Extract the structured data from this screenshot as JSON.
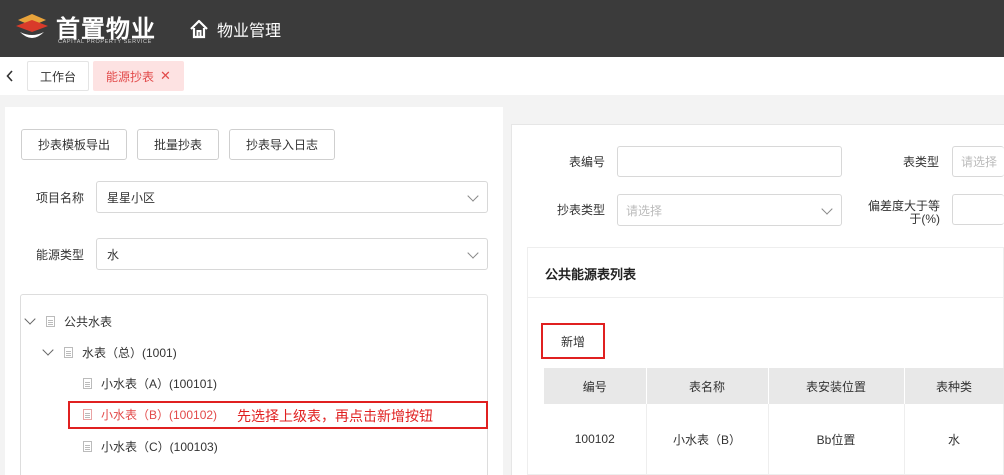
{
  "header": {
    "brand_cn": "首置物业",
    "brand_en": "CAPITAL PROPERTY SERVICE",
    "nav_title": "物业管理"
  },
  "tabs": [
    {
      "label": "工作台"
    },
    {
      "label": "能源抄表"
    }
  ],
  "left": {
    "buttons": [
      "抄表模板导出",
      "批量抄表",
      "抄表导入日志"
    ],
    "project_label": "项目名称",
    "project_value": "星星小区",
    "energy_label": "能源类型",
    "energy_value": "水",
    "tree": [
      {
        "label": "公共水表"
      },
      {
        "label": "水表（总）(1001)"
      },
      {
        "label": "小水表（A）(100101)"
      },
      {
        "label": "小水表（B）(100102)"
      },
      {
        "label": "小水表（C）(100103)"
      }
    ],
    "annotation": "先选择上级表，再点击新增按钮"
  },
  "right": {
    "meter_no_label": "表编号",
    "meter_type_label": "表类型",
    "meter_type_placeholder": "请选择",
    "read_type_label": "抄表类型",
    "read_type_placeholder": "请选择",
    "deviation_label_1": "偏差度大于等",
    "deviation_label_2": "于(%)",
    "list_title": "公共能源表列表",
    "add_button": "新增",
    "table": {
      "headers": [
        "编号",
        "表名称",
        "表安装位置",
        "表种类"
      ],
      "rows": [
        [
          "100102",
          "小水表（B）",
          "Bb位置",
          "水"
        ]
      ]
    }
  },
  "colors": {
    "topbar": "#3b3b3b",
    "active_tab_bg": "#fde2e2",
    "accent_red": "#e02020"
  }
}
